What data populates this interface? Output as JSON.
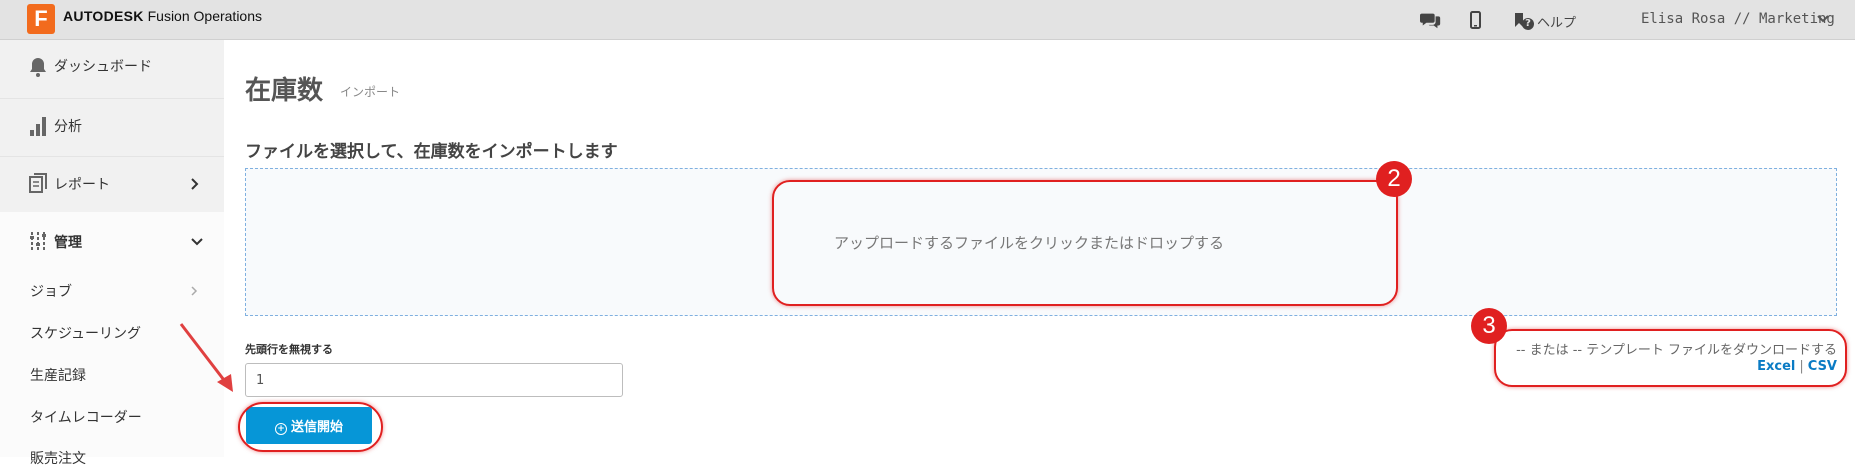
{
  "header": {
    "logo_letter": "F",
    "brand_bold": "AUTODESK",
    "brand_name": "Fusion Operations",
    "help_label": "ヘルプ",
    "user_label": "Elisa Rosa // Marketing"
  },
  "sidebar": {
    "items": [
      {
        "label": "ダッシュボード"
      },
      {
        "label": "分析"
      },
      {
        "label": "レポート"
      },
      {
        "label": "管理"
      }
    ],
    "sub_items": [
      {
        "label": "ジョブ"
      },
      {
        "label": "スケジューリング"
      },
      {
        "label": "生産記録"
      },
      {
        "label": "タイムレコーダー"
      },
      {
        "label": "販売注文"
      }
    ]
  },
  "main": {
    "title": "在庫数",
    "subtitle": "インポート",
    "section_heading": "ファイルを選択して、在庫数をインポートします",
    "dropzone_text": "アップロードするファイルをクリックまたはドロップする",
    "ignore_header_label": "先頭行を無視する",
    "ignore_header_value": "1",
    "submit_label": "送信開始",
    "template_text": "-- または -- テンプレート ファイルをダウンロードする",
    "template_excel": "Excel",
    "template_sep": "|",
    "template_csv": "CSV"
  },
  "annotations": {
    "badge_2": "2",
    "badge_3": "3",
    "color": "#e02020"
  },
  "colors": {
    "accent": "#0696d7",
    "logo": "#f26b1d",
    "topbar": "#e3e3e3",
    "sidebar": "#f1f1f1"
  }
}
